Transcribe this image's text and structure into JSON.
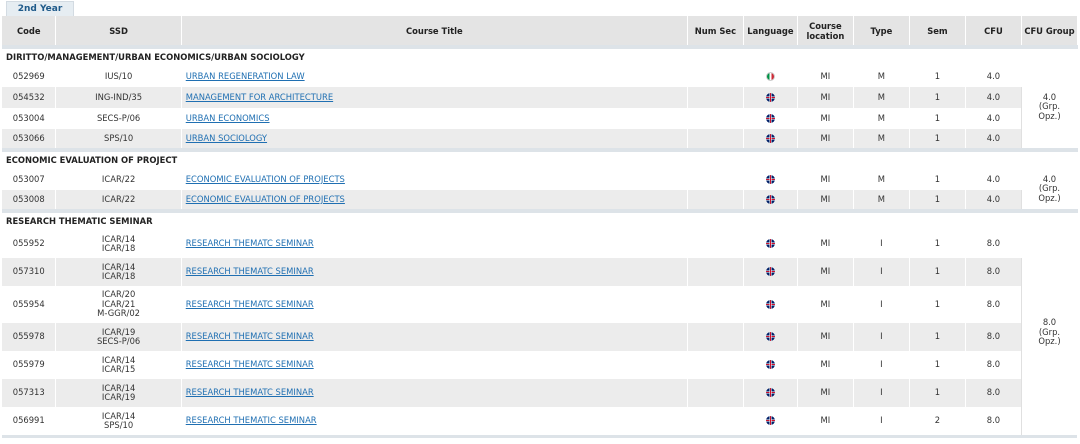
{
  "tab": {
    "label": "2nd Year"
  },
  "headers": {
    "code": "Code",
    "ssd": "SSD",
    "title": "Course Title",
    "numsec": "Num Sec",
    "language": "Language",
    "location1": "Course",
    "location2": "location",
    "type": "Type",
    "sem": "Sem",
    "cfu": "CFU",
    "cfugroup": "CFU Group"
  },
  "groups": [
    {
      "name": "DIRITTO/MANAGEMENT/URBAN ECONOMICS/URBAN SOCIOLOGY",
      "cfu_group": [
        "4.0",
        "(Grp.",
        "Opz.)"
      ],
      "rows": [
        {
          "code": "052969",
          "ssd": [
            "IUS/10"
          ],
          "title": "URBAN REGENERATION LAW",
          "lang": "it",
          "loc": "MI",
          "type": "M",
          "sem": "1",
          "cfu": "4.0"
        },
        {
          "code": "054532",
          "ssd": [
            "ING-IND/35"
          ],
          "title": "MANAGEMENT FOR ARCHITECTURE",
          "lang": "en",
          "loc": "MI",
          "type": "M",
          "sem": "1",
          "cfu": "4.0"
        },
        {
          "code": "053004",
          "ssd": [
            "SECS-P/06"
          ],
          "title": "URBAN ECONOMICS",
          "lang": "en",
          "loc": "MI",
          "type": "M",
          "sem": "1",
          "cfu": "4.0"
        },
        {
          "code": "053066",
          "ssd": [
            "SPS/10"
          ],
          "title": "URBAN SOCIOLOGY",
          "lang": "en",
          "loc": "MI",
          "type": "M",
          "sem": "1",
          "cfu": "4.0"
        }
      ]
    },
    {
      "name": "ECONOMIC EVALUATION OF PROJECT",
      "cfu_group": [
        "4.0",
        "(Grp.",
        "Opz.)"
      ],
      "rows": [
        {
          "code": "053007",
          "ssd": [
            "ICAR/22"
          ],
          "title": "ECONOMIC EVALUATION OF PROJECTS",
          "lang": "en",
          "loc": "MI",
          "type": "M",
          "sem": "1",
          "cfu": "4.0"
        },
        {
          "code": "053008",
          "ssd": [
            "ICAR/22"
          ],
          "title": "ECONOMIC EVALUATION OF PROJECTS",
          "lang": "en",
          "loc": "MI",
          "type": "M",
          "sem": "1",
          "cfu": "4.0"
        }
      ]
    },
    {
      "name": "RESEARCH THEMATIC SEMINAR",
      "cfu_group": [
        "8.0",
        "(Grp.",
        "Opz.)"
      ],
      "rows": [
        {
          "code": "055952",
          "ssd": [
            "ICAR/14",
            "ICAR/18"
          ],
          "title": "RESEARCH THEMATC SEMINAR",
          "lang": "en",
          "loc": "MI",
          "type": "I",
          "sem": "1",
          "cfu": "8.0"
        },
        {
          "code": "057310",
          "ssd": [
            "ICAR/14",
            "ICAR/18"
          ],
          "title": "RESEARCH THEMATC SEMINAR",
          "lang": "en",
          "loc": "MI",
          "type": "I",
          "sem": "1",
          "cfu": "8.0"
        },
        {
          "code": "055954",
          "ssd": [
            "ICAR/20",
            "ICAR/21",
            "M-GGR/02"
          ],
          "title": "RESEARCH THEMATC SEMINAR",
          "lang": "en",
          "loc": "MI",
          "type": "I",
          "sem": "1",
          "cfu": "8.0"
        },
        {
          "code": "055978",
          "ssd": [
            "ICAR/19",
            "SECS-P/06"
          ],
          "title": "RESEARCH THEMATC SEMINAR",
          "lang": "en",
          "loc": "MI",
          "type": "I",
          "sem": "1",
          "cfu": "8.0"
        },
        {
          "code": "055979",
          "ssd": [
            "ICAR/14",
            "ICAR/15"
          ],
          "title": "RESEARCH THEMATC SEMINAR",
          "lang": "en",
          "loc": "MI",
          "type": "I",
          "sem": "1",
          "cfu": "8.0"
        },
        {
          "code": "057313",
          "ssd": [
            "ICAR/14",
            "ICAR/19"
          ],
          "title": "RESEARCH THEMATC SEMINAR",
          "lang": "en",
          "loc": "MI",
          "type": "I",
          "sem": "1",
          "cfu": "8.0"
        },
        {
          "code": "056991",
          "ssd": [
            "ICAR/14",
            "SPS/10"
          ],
          "title": "RESEARCH THEMATIC SEMINAR",
          "lang": "en",
          "loc": "MI",
          "type": "I",
          "sem": "2",
          "cfu": "8.0"
        }
      ]
    }
  ]
}
